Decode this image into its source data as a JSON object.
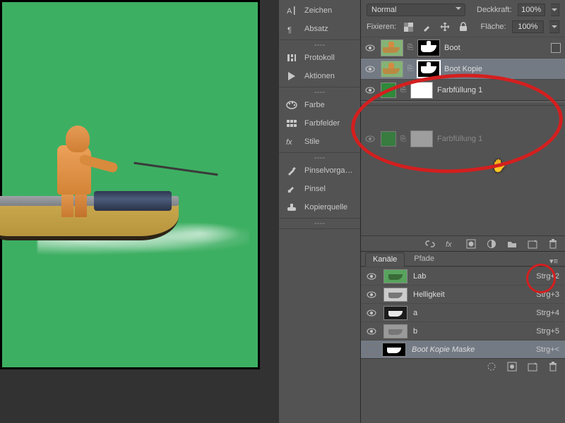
{
  "topbar": {
    "blend_mode": "Normal",
    "opacity_label": "Deckkraft:",
    "opacity_value": "100%",
    "lock_label": "Fixieren:",
    "fill_label": "Fläche:",
    "fill_value": "100%"
  },
  "mid_panels": [
    {
      "icon": "character-icon",
      "label": "Zeichen"
    },
    {
      "icon": "paragraph-icon",
      "label": "Absatz"
    },
    {
      "icon": "history-icon",
      "label": "Protokoll"
    },
    {
      "icon": "actions-icon",
      "label": "Aktionen"
    },
    {
      "icon": "color-icon",
      "label": "Farbe"
    },
    {
      "icon": "swatches-icon",
      "label": "Farbfelder"
    },
    {
      "icon": "styles-icon",
      "label": "Stile"
    },
    {
      "icon": "brushpresets-icon",
      "label": "Pinselvorga…"
    },
    {
      "icon": "brush-icon",
      "label": "Pinsel"
    },
    {
      "icon": "clonesource-icon",
      "label": "Kopierquelle"
    }
  ],
  "layers": [
    {
      "name": "Boot",
      "selected": false,
      "mask": "black-sil"
    },
    {
      "name": "Boot Kopie",
      "selected": true,
      "mask": "black-sil-outline"
    },
    {
      "name": "Farbfüllung 1",
      "selected": false,
      "kind": "fill",
      "mask": "white"
    }
  ],
  "ghost_layer": {
    "name": "Farbfüllung 1",
    "mask": "grey"
  },
  "channels_tabs": {
    "active": "Kanäle",
    "other": "Pfade"
  },
  "channels": [
    {
      "name": "Lab",
      "shortcut": "Strg+2",
      "thumb": "green",
      "visible": true
    },
    {
      "name": "Helligkeit",
      "shortcut": "Strg+3",
      "thumb": "light",
      "visible": true
    },
    {
      "name": "a",
      "shortcut": "Strg+4",
      "thumb": "dark",
      "visible": true
    },
    {
      "name": "b",
      "shortcut": "Strg+5",
      "thumb": "mid",
      "visible": true
    },
    {
      "name": "Boot Kopie Maske",
      "shortcut": "Strg+<",
      "thumb": "mask",
      "visible": false,
      "italic": true,
      "selected": true
    }
  ]
}
